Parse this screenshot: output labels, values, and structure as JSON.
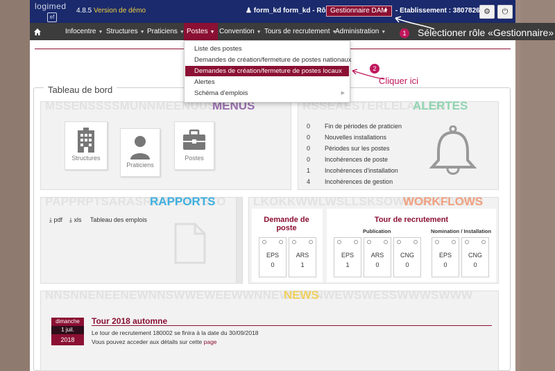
{
  "header": {
    "logo_text": "logimed",
    "logo_mark": "ef",
    "version": "4.8.5",
    "demo_label": "Version de démo",
    "user_label": "form_kd form_kd",
    "role_label": "- Rôle :",
    "role_value": "Gestionnaire DAM",
    "etab_label": "- Etablissement : 380782698"
  },
  "nav": {
    "items": [
      {
        "label": "Infocentre"
      },
      {
        "label": "Structures"
      },
      {
        "label": "Praticiens"
      },
      {
        "label": "Postes"
      },
      {
        "label": "Convention"
      },
      {
        "label": "Tours de recrutement"
      },
      {
        "label": "Administration"
      }
    ]
  },
  "annotations": {
    "step1_num": "1",
    "step1_text": "Sélectioner rôle «Gestionnaire»",
    "step2_num": "2",
    "step2_text": "Cliquer ici"
  },
  "dropdown": {
    "items": [
      {
        "label": "Liste des postes"
      },
      {
        "label": "Demandes de création/fermeture de postes nationaux"
      },
      {
        "label": "Demandes de création/fermeture de postes locaux"
      },
      {
        "label": "Alertes"
      },
      {
        "label": "Schéma d'emplois"
      }
    ]
  },
  "dashboard": {
    "title": "Tableau de bord",
    "menus": {
      "bg": "MSSENSSSSMUNNMEENUUSU",
      "title": "MENUS",
      "tiles": [
        {
          "label": "Structures"
        },
        {
          "label": "Praticiens"
        },
        {
          "label": "Postes"
        }
      ]
    },
    "alertes": {
      "bg": "RSSEAESTERLELALLSS",
      "title": "ALERTES",
      "rows": [
        {
          "count": "0",
          "label": "Fin de périodes de praticien"
        },
        {
          "count": "0",
          "label": "Nouvelles installations"
        },
        {
          "count": "0",
          "label": "Périodes sur les postes"
        },
        {
          "count": "0",
          "label": "Incohérences de poste"
        },
        {
          "count": "1",
          "label": "Incohérences d'installation"
        },
        {
          "count": "4",
          "label": "Incohérences de gestion"
        }
      ]
    },
    "rapports": {
      "bg": "PAPPRPTSARASRAPPORTSTO",
      "title": "RAPPORTS",
      "pdf": "pdf",
      "xls": "xls",
      "report": "Tableau des emplois"
    },
    "workflows": {
      "bg": "LKOKKWWLWSLLSKSOWORKFLOWSR",
      "title": "WORKFLOWS",
      "demande_title": "Demande de poste",
      "tour_title": "Tour de recrutement",
      "publication_label": "Publication",
      "nomination_label": "Nomination / Installation",
      "demande_cards": [
        {
          "label": "EPS",
          "value": "0"
        },
        {
          "label": "ARS",
          "value": "1"
        }
      ],
      "publication_cards": [
        {
          "label": "EPS",
          "value": "1"
        },
        {
          "label": "ARS",
          "value": "0"
        },
        {
          "label": "CNG",
          "value": "0"
        }
      ],
      "nomination_cards": [
        {
          "label": "EPS",
          "value": "0"
        },
        {
          "label": "CNG",
          "value": "0"
        }
      ]
    },
    "news": {
      "bg": "NNSNNENEENEWNNSWWEWEEWWNNEWSEENWEWSWESSWWWSWWW",
      "title": "NEWS",
      "day": "dimanche",
      "date": "1 juil.",
      "year": "2018",
      "item_title": "Tour 2018 automne",
      "line1": "Le tour de recrutement 180002 se finira à la date du 30/09/2018",
      "line2_prefix": "Vous pouvez acceder aux détails sur cette",
      "line2_link": "page"
    }
  },
  "colors": {
    "navy": "#1a2a6c",
    "brand": "#8b1033",
    "menus": "#9b6fb0",
    "alertes": "#8fd4b0",
    "rapports": "#3fb0e0",
    "workflows": "#f0a080",
    "news": "#f0d060"
  }
}
